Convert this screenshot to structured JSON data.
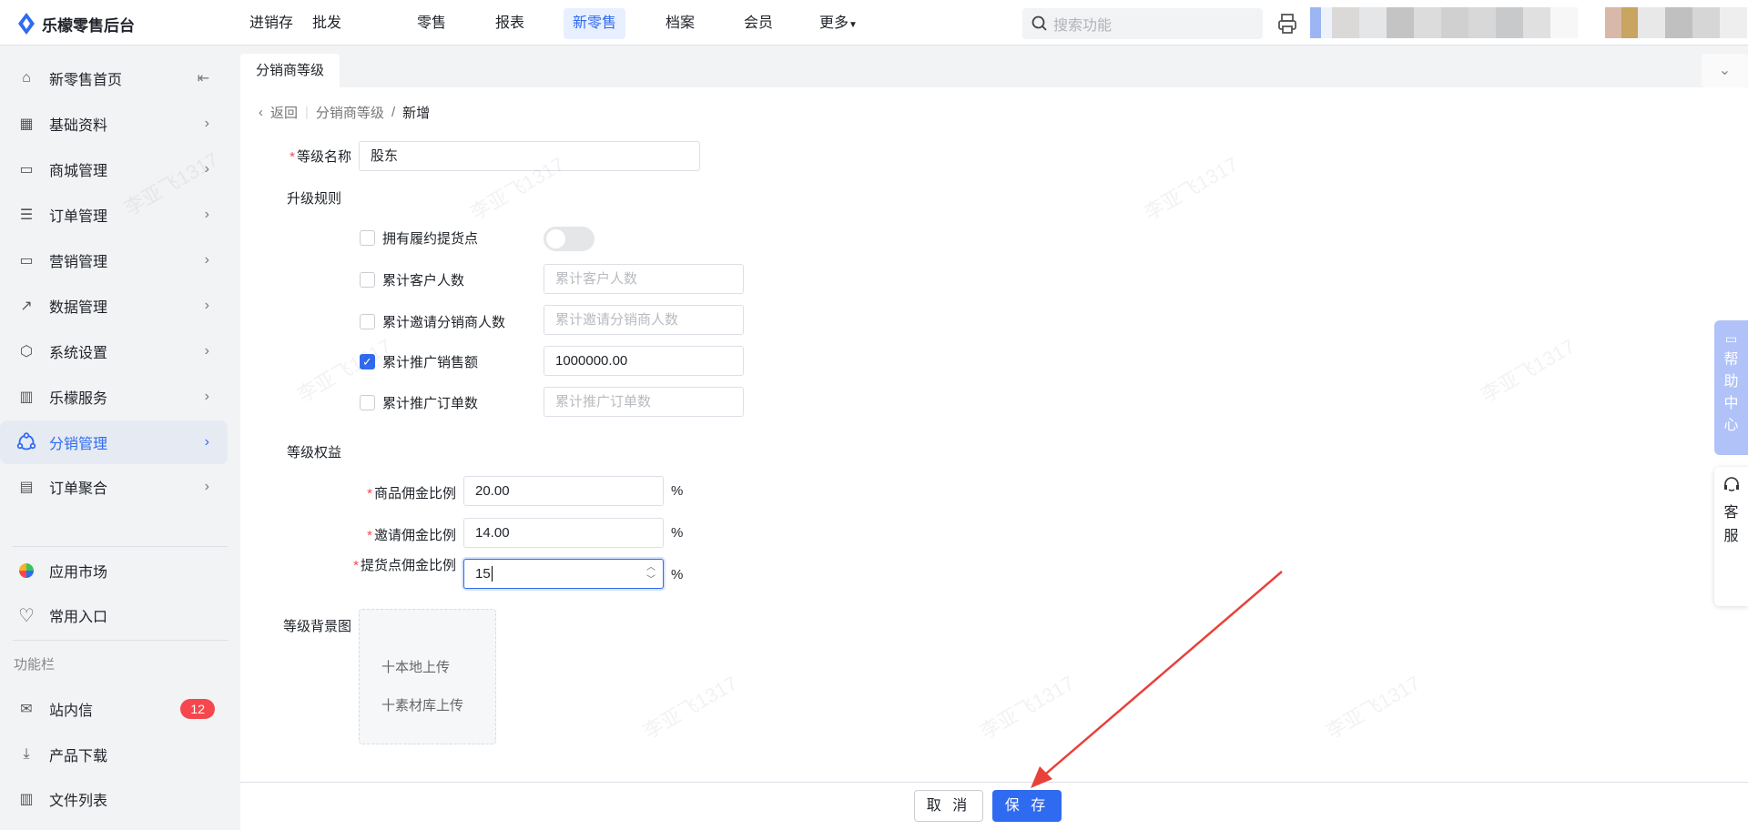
{
  "app": {
    "title": "乐檬零售后台"
  },
  "nav": {
    "items": [
      "进销存",
      "批发",
      "零售",
      "报表",
      "新零售",
      "档案",
      "会员",
      "更多"
    ],
    "active": "新零售"
  },
  "search": {
    "placeholder": "搜索功能"
  },
  "sidebar": {
    "items": [
      {
        "label": "新零售首页",
        "icon": "home-icon"
      },
      {
        "label": "基础资料",
        "icon": "grid-icon"
      },
      {
        "label": "商城管理",
        "icon": "store-icon"
      },
      {
        "label": "订单管理",
        "icon": "order-icon"
      },
      {
        "label": "营销管理",
        "icon": "monitor-icon"
      },
      {
        "label": "数据管理",
        "icon": "chart-icon"
      },
      {
        "label": "系统设置",
        "icon": "settings-icon"
      },
      {
        "label": "乐檬服务",
        "icon": "service-icon"
      },
      {
        "label": "分销管理",
        "icon": "distribution-icon"
      },
      {
        "label": "订单聚合",
        "icon": "order-aggregate-icon"
      }
    ],
    "active": "分销管理",
    "extra": [
      {
        "label": "应用市场"
      },
      {
        "label": "常用入口"
      }
    ],
    "section_title": "功能栏",
    "tools": [
      {
        "label": "站内信",
        "badge": "12"
      },
      {
        "label": "产品下载"
      },
      {
        "label": "文件列表"
      }
    ]
  },
  "tabs": {
    "current": "分销商等级"
  },
  "breadcrumb": {
    "back": "返回",
    "parent": "分销商等级",
    "sep": "/",
    "current": "新增"
  },
  "form": {
    "level_name": {
      "label": "等级名称",
      "value": "股东"
    },
    "upgrade_rules_title": "升级规则",
    "rules": [
      {
        "label": "拥有履约提货点",
        "checked": false,
        "type": "toggle",
        "on": false
      },
      {
        "label": "累计客户人数",
        "checked": false,
        "placeholder": "累计客户人数",
        "value": ""
      },
      {
        "label": "累计邀请分销商人数",
        "checked": false,
        "placeholder": "累计邀请分销商人数",
        "value": ""
      },
      {
        "label": "累计推广销售额",
        "checked": true,
        "placeholder": "",
        "value": "1000000.00"
      },
      {
        "label": "累计推广订单数",
        "checked": false,
        "placeholder": "累计推广订单数",
        "value": ""
      }
    ],
    "benefits_title": "等级权益",
    "benefits": [
      {
        "label": "商品佣金比例",
        "value": "20.00",
        "unit": "%"
      },
      {
        "label": "邀请佣金比例",
        "value": "14.00",
        "unit": "%"
      },
      {
        "label": "提货点佣金比例",
        "value": "15",
        "unit": "%"
      }
    ],
    "bg_label": "等级背景图",
    "upload_local": "十本地上传",
    "upload_library": "十素材库上传"
  },
  "footer": {
    "cancel": "取 消",
    "save": "保 存"
  },
  "rail": {
    "help": [
      "帮",
      "助",
      "中",
      "心"
    ],
    "service": [
      "客",
      "服"
    ]
  },
  "watermark": "李亚飞1317",
  "colors": {
    "primary": "#2f6bf0",
    "badge": "#f5474d",
    "annotation": "#e8413a"
  }
}
